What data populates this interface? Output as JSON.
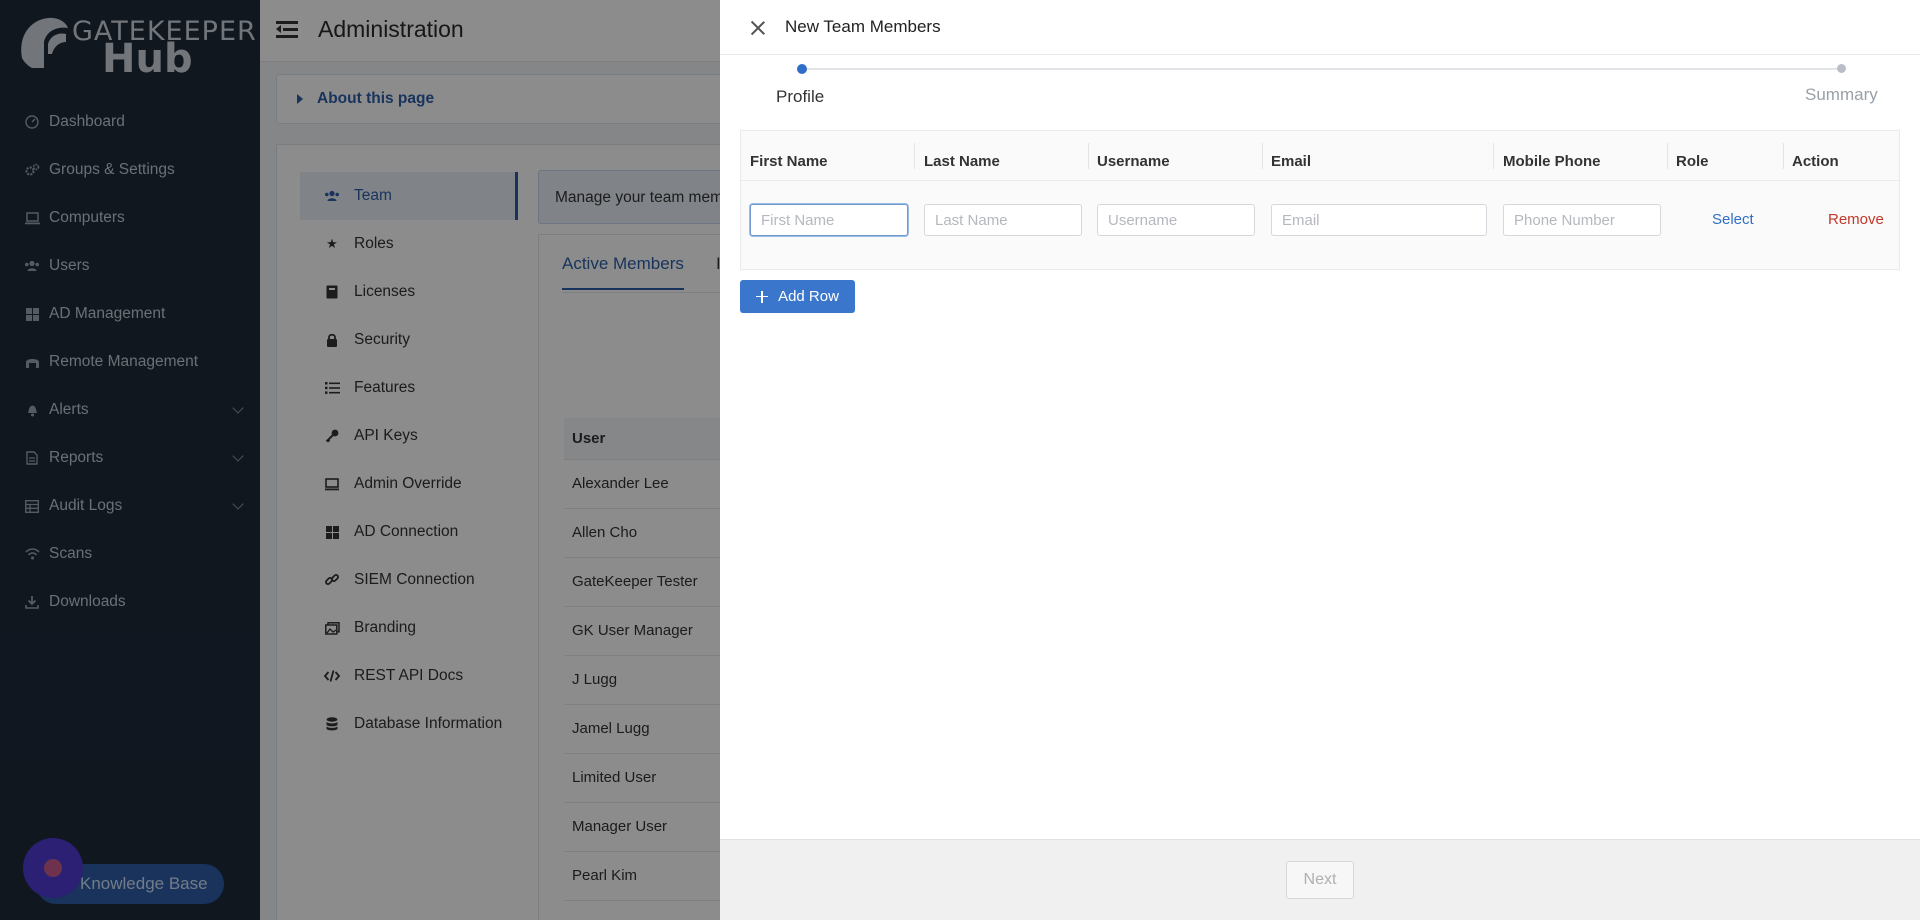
{
  "app": {
    "brand_top": "GATEKEEPER",
    "brand_bottom": "Hub",
    "page_title": "Administration"
  },
  "sidebar": {
    "items": [
      {
        "label": "Dashboard",
        "icon": "dashboard-icon"
      },
      {
        "label": "Groups & Settings",
        "icon": "gears-icon"
      },
      {
        "label": "Computers",
        "icon": "laptop-icon"
      },
      {
        "label": "Users",
        "icon": "users-icon"
      },
      {
        "label": "AD Management",
        "icon": "windows-icon"
      },
      {
        "label": "Remote Management",
        "icon": "remote-icon"
      },
      {
        "label": "Alerts",
        "icon": "bell-icon",
        "expandable": true
      },
      {
        "label": "Reports",
        "icon": "file-icon",
        "expandable": true
      },
      {
        "label": "Audit Logs",
        "icon": "table-icon",
        "expandable": true
      },
      {
        "label": "Scans",
        "icon": "wifi-icon"
      },
      {
        "label": "Downloads",
        "icon": "download-icon"
      }
    ],
    "knowledge_base": "Knowledge Base"
  },
  "main": {
    "about_label": "About this page",
    "submenu": [
      {
        "label": "Team",
        "icon": "team-icon",
        "active": true
      },
      {
        "label": "Roles",
        "icon": "star-icon"
      },
      {
        "label": "Licenses",
        "icon": "book-icon"
      },
      {
        "label": "Security",
        "icon": "lock-icon"
      },
      {
        "label": "Features",
        "icon": "list-icon"
      },
      {
        "label": "API Keys",
        "icon": "key-icon"
      },
      {
        "label": "Admin Override",
        "icon": "monitor-icon"
      },
      {
        "label": "AD Connection",
        "icon": "windows-icon"
      },
      {
        "label": "SIEM Connection",
        "icon": "link-icon"
      },
      {
        "label": "Branding",
        "icon": "images-icon"
      },
      {
        "label": "REST API Docs",
        "icon": "code-icon"
      },
      {
        "label": "Database Information",
        "icon": "database-icon"
      }
    ],
    "manage_text": "Manage your team memb",
    "tab_active": "Active Members",
    "tab_second": "I",
    "table_header": "User",
    "users": [
      "Alexander Lee",
      "Allen Cho",
      "GateKeeper Tester",
      "GK User Manager",
      "J Lugg",
      "Jamel Lugg",
      "Limited User",
      "Manager User",
      "Pearl Kim"
    ]
  },
  "drawer": {
    "title": "New Team Members",
    "steps": [
      "Profile",
      "Summary"
    ],
    "columns": [
      "First Name",
      "Last Name",
      "Username",
      "Email",
      "Mobile Phone",
      "Role",
      "Action"
    ],
    "row": {
      "first_name": {
        "value": "",
        "placeholder": "First Name"
      },
      "last_name": {
        "value": "",
        "placeholder": "Last Name"
      },
      "username": {
        "value": "",
        "placeholder": "Username"
      },
      "email": {
        "value": "",
        "placeholder": "Email"
      },
      "phone": {
        "value": "",
        "placeholder": "Phone Number"
      },
      "role_link": "Select",
      "action_link": "Remove"
    },
    "add_row_label": "Add Row",
    "next_label": "Next"
  },
  "colors": {
    "sidebar_bg": "#1e2a3a",
    "accent": "#2f6ec6",
    "danger": "#c0392b",
    "add_button": "#3a76cc"
  }
}
